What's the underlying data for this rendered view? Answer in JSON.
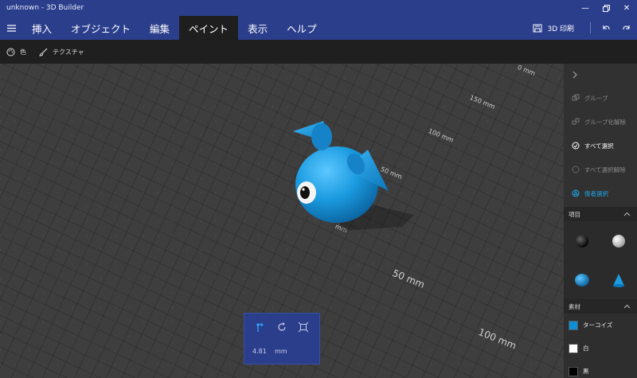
{
  "app": {
    "window_title": "unknown - 3D Builder"
  },
  "menu": {
    "tabs": [
      {
        "label": "挿入"
      },
      {
        "label": "オブジェクト"
      },
      {
        "label": "編集"
      },
      {
        "label": "ペイント",
        "active": true
      },
      {
        "label": "表示"
      },
      {
        "label": "ヘルプ"
      }
    ],
    "print_label": "3D 印刷"
  },
  "subtoolbar": {
    "color_label": "色",
    "texture_label": "テクスチャ"
  },
  "viewport": {
    "rulers": [
      "150 mm",
      "100 mm",
      "50 mm",
      "mm",
      "50 mm",
      "100 mm",
      "0 mm"
    ],
    "model_color": "#1b9be0"
  },
  "move_panel": {
    "value": "4.81",
    "unit": "mm"
  },
  "right_panel": {
    "actions": [
      {
        "label": "グループ",
        "icon": "group-icon",
        "state": "disabled"
      },
      {
        "label": "グループ化解除",
        "icon": "ungroup-icon",
        "state": "disabled"
      },
      {
        "label": "すべて選択",
        "icon": "select-all-icon",
        "state": "enabled"
      },
      {
        "label": "すべて選択解除",
        "icon": "deselect-all-icon",
        "state": "disabled"
      },
      {
        "label": "復者選択",
        "icon": "multi-select-icon",
        "state": "accent"
      }
    ],
    "items_header": "項目",
    "materials_header": "素材",
    "materials": [
      {
        "label": "ターコイズ",
        "color": "#0d8fd8"
      },
      {
        "label": "白",
        "color": "#ffffff"
      },
      {
        "label": "黒",
        "color": "#000000"
      }
    ]
  },
  "colors": {
    "accent": "#1ea7e8",
    "titlebar": "#2b3e8c"
  }
}
